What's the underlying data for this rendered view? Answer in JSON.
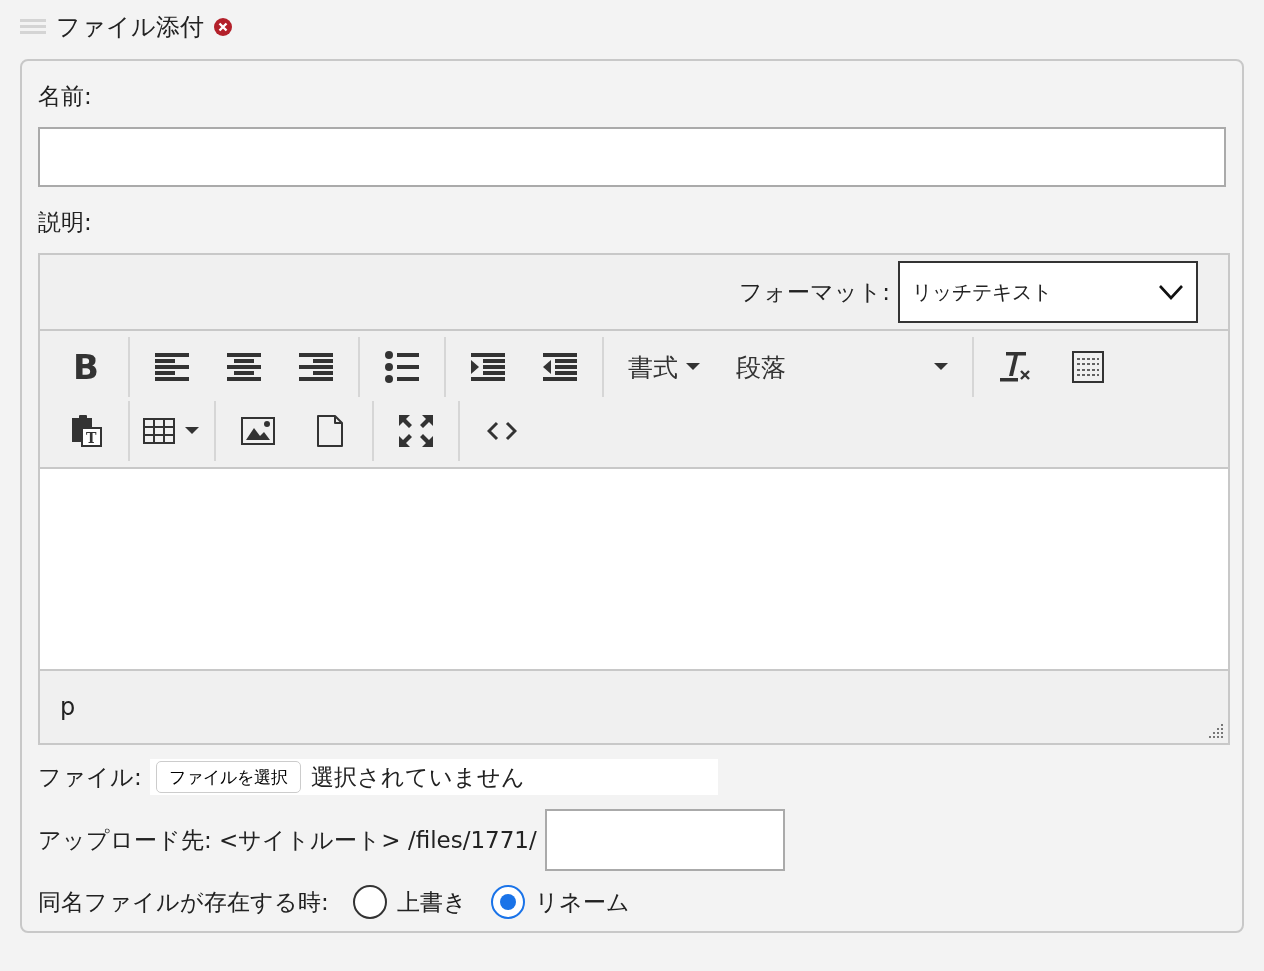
{
  "section": {
    "title": "ファイル添付"
  },
  "name_field": {
    "label": "名前:"
  },
  "description": {
    "label": "説明:",
    "format_label": "フォーマット:",
    "format_value": "リッチテキスト",
    "toolbar_rows": [
      [
        [
          {
            "kind": "bold",
            "glyph": "B"
          }
        ],
        [
          {
            "kind": "align-left"
          },
          {
            "kind": "align-center"
          },
          {
            "kind": "align-right"
          }
        ],
        [
          {
            "kind": "bullet-list"
          }
        ],
        [
          {
            "kind": "indent"
          },
          {
            "kind": "outdent"
          }
        ],
        [
          {
            "kind": "menu",
            "label": "書式"
          },
          {
            "kind": "select",
            "label": "段落"
          }
        ],
        [
          {
            "kind": "clear-format"
          },
          {
            "kind": "blocks"
          }
        ]
      ],
      [
        [
          {
            "kind": "paste-text",
            "glyph": "T"
          }
        ],
        [
          {
            "kind": "table"
          }
        ],
        [
          {
            "kind": "image"
          },
          {
            "kind": "page"
          }
        ],
        [
          {
            "kind": "fullscreen"
          }
        ],
        [
          {
            "kind": "code"
          }
        ]
      ]
    ],
    "path": "p"
  },
  "file": {
    "label": "ファイル:",
    "button": "ファイルを選択",
    "status": "選択されていません"
  },
  "upload": {
    "label": "アップロード先: <サイトルート> /files/1771/"
  },
  "overwrite": {
    "label": "同名ファイルが存在する時:",
    "options": [
      {
        "label": "上書き",
        "selected": false
      },
      {
        "label": "リネーム",
        "selected": true
      }
    ]
  }
}
